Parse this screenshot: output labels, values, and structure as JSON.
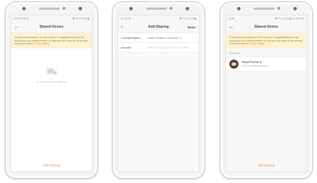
{
  "phones": [
    {
      "status_left": "9:13 ✉ ✉ ✉",
      "status_right": "✱ ⁴ᴳ.ıl 76% ▮",
      "back": "←",
      "title": "Shared Device",
      "notice": "If a permanent resident is in the house, it is suggested that you set that person as a family member, so that they can share all the devices and smart scenes.",
      "notice_link": "Family Setting",
      "empty_text": "No shared devices added yet",
      "add": "Add Sharing"
    },
    {
      "status_left": "11:10 ✉",
      "status_right": "✱ ⁴ᴳ.ıl 61% ▮",
      "back": "‹",
      "title": "Add Sharing",
      "done": "Done",
      "region_label": "Country/Region",
      "region_value": "United States of America +1",
      "account_label": "Account",
      "account_placeholder": "Enter mobile phone number/email"
    },
    {
      "status_left": "▢ ✉",
      "status_right": "✱ ⁴ᴳ.ıl 61% ▮ 11:10 PM",
      "back": "←",
      "title": "Shared Device",
      "notice": "If a permanent resident is in the house, it is suggested that you set that person as a family member, so that they can share all the devices and smart scenes.",
      "notice_link": "Family Setting",
      "section": "Shared to",
      "member_name": "Novel home 2",
      "member_email": "novel.home@gmail.com",
      "add": "Add Sharing"
    }
  ]
}
